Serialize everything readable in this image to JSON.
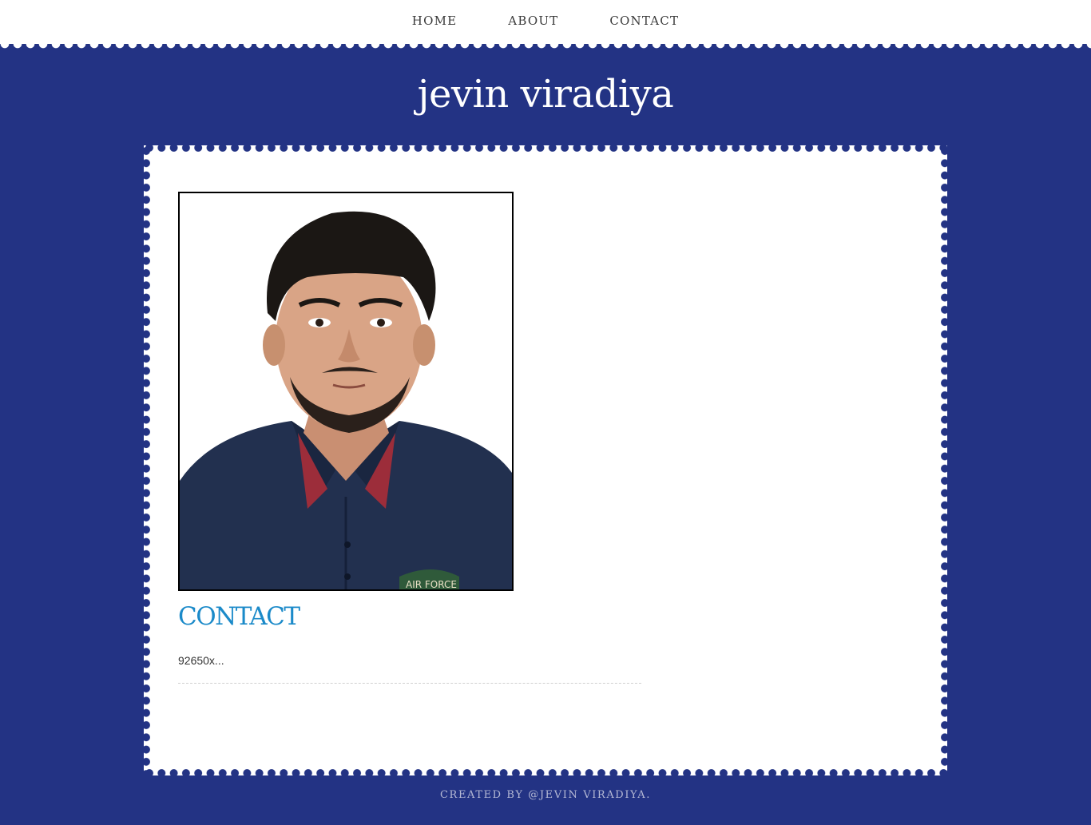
{
  "nav": {
    "items": [
      {
        "label": "HOME"
      },
      {
        "label": "ABOUT"
      },
      {
        "label": "CONTACT"
      }
    ]
  },
  "header": {
    "title": "jevin viradiya"
  },
  "main": {
    "photo": {
      "alt": "Portrait photo",
      "shirt_patch_text": "AIR FORCE"
    },
    "heading": "CONTACT",
    "phone": "92650x..."
  },
  "footer": {
    "credit": "CREATED BY @JEVIN VIRADIYA."
  },
  "colors": {
    "background": "#233384",
    "card": "#ffffff",
    "heading": "#1b8ac9",
    "nav_text": "#3a3a3a",
    "footer_text": "#b4b8d4"
  }
}
